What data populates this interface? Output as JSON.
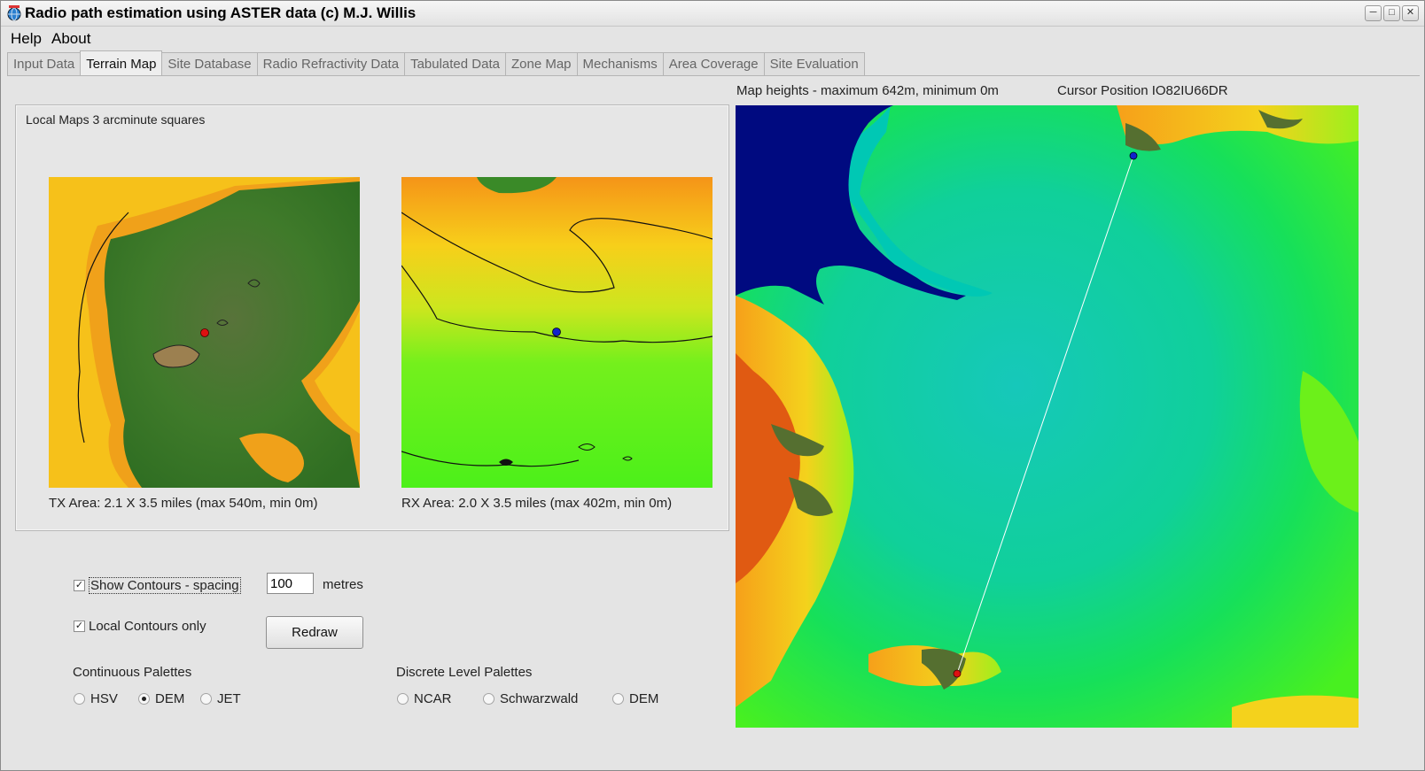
{
  "window": {
    "title": "Radio path estimation using ASTER data (c) M.J. Willis",
    "icon": "globe-icon",
    "controls": [
      "─",
      "□",
      "✕"
    ]
  },
  "menu": [
    "Help",
    "About"
  ],
  "tabs": [
    {
      "label": "Input Data",
      "active": false
    },
    {
      "label": "Terrain Map",
      "active": true
    },
    {
      "label": "Site Database",
      "active": false
    },
    {
      "label": "Radio Refractivity Data",
      "active": false
    },
    {
      "label": "Tabulated Data",
      "active": false
    },
    {
      "label": "Zone Map",
      "active": false
    },
    {
      "label": "Mechanisms",
      "active": false
    },
    {
      "label": "Area Coverage",
      "active": false
    },
    {
      "label": "Site Evaluation",
      "active": false
    }
  ],
  "local_maps": {
    "title": "Local Maps 3 arcminute squares",
    "tx_caption": "TX Area: 2.1 X 3.5 miles  (max 540m,  min 0m)",
    "rx_caption": "RX Area: 2.0 X 3.5 miles  (max 402m,  min 0m)",
    "tx_marker_color": "#dd1111",
    "rx_marker_color": "#1122cc"
  },
  "controls": {
    "show_contours_label": "Show Contours - spacing",
    "show_contours_checked": true,
    "spacing_value": "100",
    "spacing_unit": "metres",
    "local_contours_label": "Local Contours only",
    "local_contours_checked": true,
    "redraw_label": "Redraw",
    "check_mark": "✓"
  },
  "palettes": {
    "continuous_label": "Continuous Palettes",
    "continuous": [
      {
        "label": "HSV",
        "selected": false
      },
      {
        "label": "DEM",
        "selected": true
      },
      {
        "label": "JET",
        "selected": false
      }
    ],
    "discrete_label": "Discrete Level Palettes",
    "discrete": [
      {
        "label": "NCAR",
        "selected": false
      },
      {
        "label": "Schwarzwald",
        "selected": false
      },
      {
        "label": "DEM",
        "selected": false
      }
    ]
  },
  "main_map": {
    "heights_text": "Map heights - maximum 642m,  minimum 0m",
    "cursor_text": "Cursor Position IO82IU66DR",
    "sea_color": "#000a80",
    "path_color": "#ffffff"
  }
}
